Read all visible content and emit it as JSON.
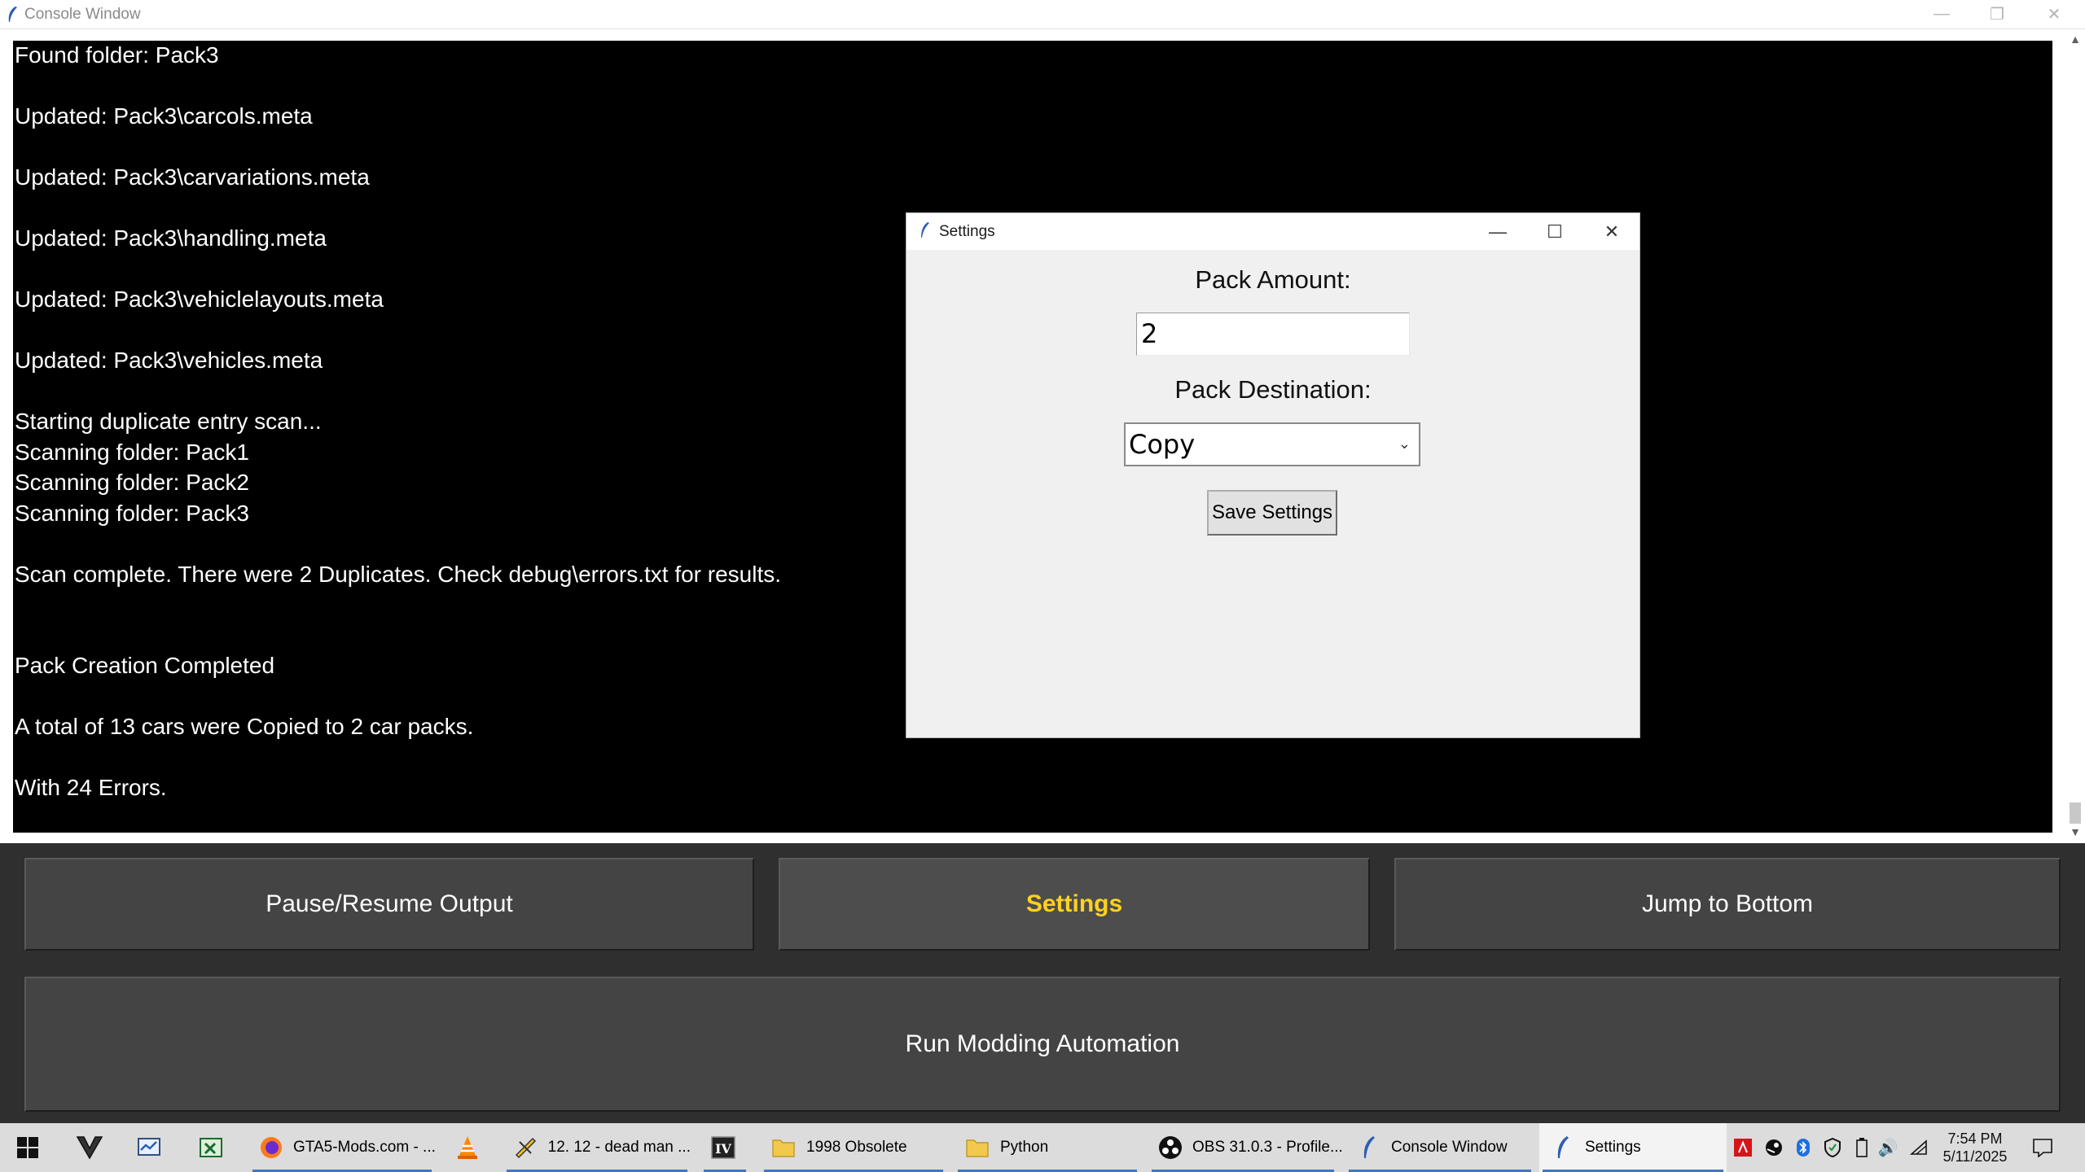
{
  "window": {
    "title": "Console Window",
    "minimize": "—",
    "restore": "❐",
    "close": "✕"
  },
  "console": {
    "lines": [
      {
        "text": "Found folder: Pack3",
        "row": 0
      },
      {
        "text": "Updated: Pack3\\carcols.meta",
        "row": 2
      },
      {
        "text": "Updated: Pack3\\carvariations.meta",
        "row": 4
      },
      {
        "text": "Updated: Pack3\\handling.meta",
        "row": 6
      },
      {
        "text": "Updated: Pack3\\vehiclelayouts.meta",
        "row": 8
      },
      {
        "text": "Updated: Pack3\\vehicles.meta",
        "row": 10
      },
      {
        "text": "Starting duplicate entry scan...",
        "row": 12
      },
      {
        "text": "Scanning folder: Pack1",
        "row": 13
      },
      {
        "text": "Scanning folder: Pack2",
        "row": 14
      },
      {
        "text": "Scanning folder: Pack3",
        "row": 15
      },
      {
        "text": "Scan complete. There were 2 Duplicates. Check debug\\errors.txt for results.",
        "row": 17
      },
      {
        "text": "Pack Creation Completed",
        "row": 20
      },
      {
        "text": "A total of 13 cars were Copied to 2 car packs.",
        "row": 22
      },
      {
        "text": "With 24 Errors.",
        "row": 24
      }
    ],
    "scroll_up": "▲",
    "scroll_down": "▼"
  },
  "buttons": {
    "pause_resume": "Pause/Resume Output",
    "settings": "Settings",
    "jump_bottom": "Jump to Bottom",
    "run_automation": "Run Modding Automation"
  },
  "colors": {
    "settings_active_text": "#ffd21f",
    "console_bg": "#000000",
    "panel_bg": "#2f2f2f"
  },
  "settings_dialog": {
    "title": "Settings",
    "minimize": "—",
    "maximize": "☐",
    "close": "✕",
    "pack_amount_label": "Pack Amount:",
    "pack_amount_value": "2",
    "pack_destination_label": "Pack Destination:",
    "pack_destination_value": "Copy",
    "dropdown_caret": "⌄",
    "save_label": "Save Settings"
  },
  "taskbar": {
    "items": [
      {
        "label": "GTA5-Mods.com - ..."
      },
      {
        "label": "12. 12 - dead man ..."
      },
      {
        "label": "1998 Obsolete"
      },
      {
        "label": "Python"
      },
      {
        "label": "OBS 31.0.3 - Profile..."
      },
      {
        "label": "Console Window"
      },
      {
        "label": "Settings"
      }
    ],
    "clock_time": "7:54 PM",
    "clock_date": "5/11/2025",
    "tray_speaker": "🔊"
  }
}
